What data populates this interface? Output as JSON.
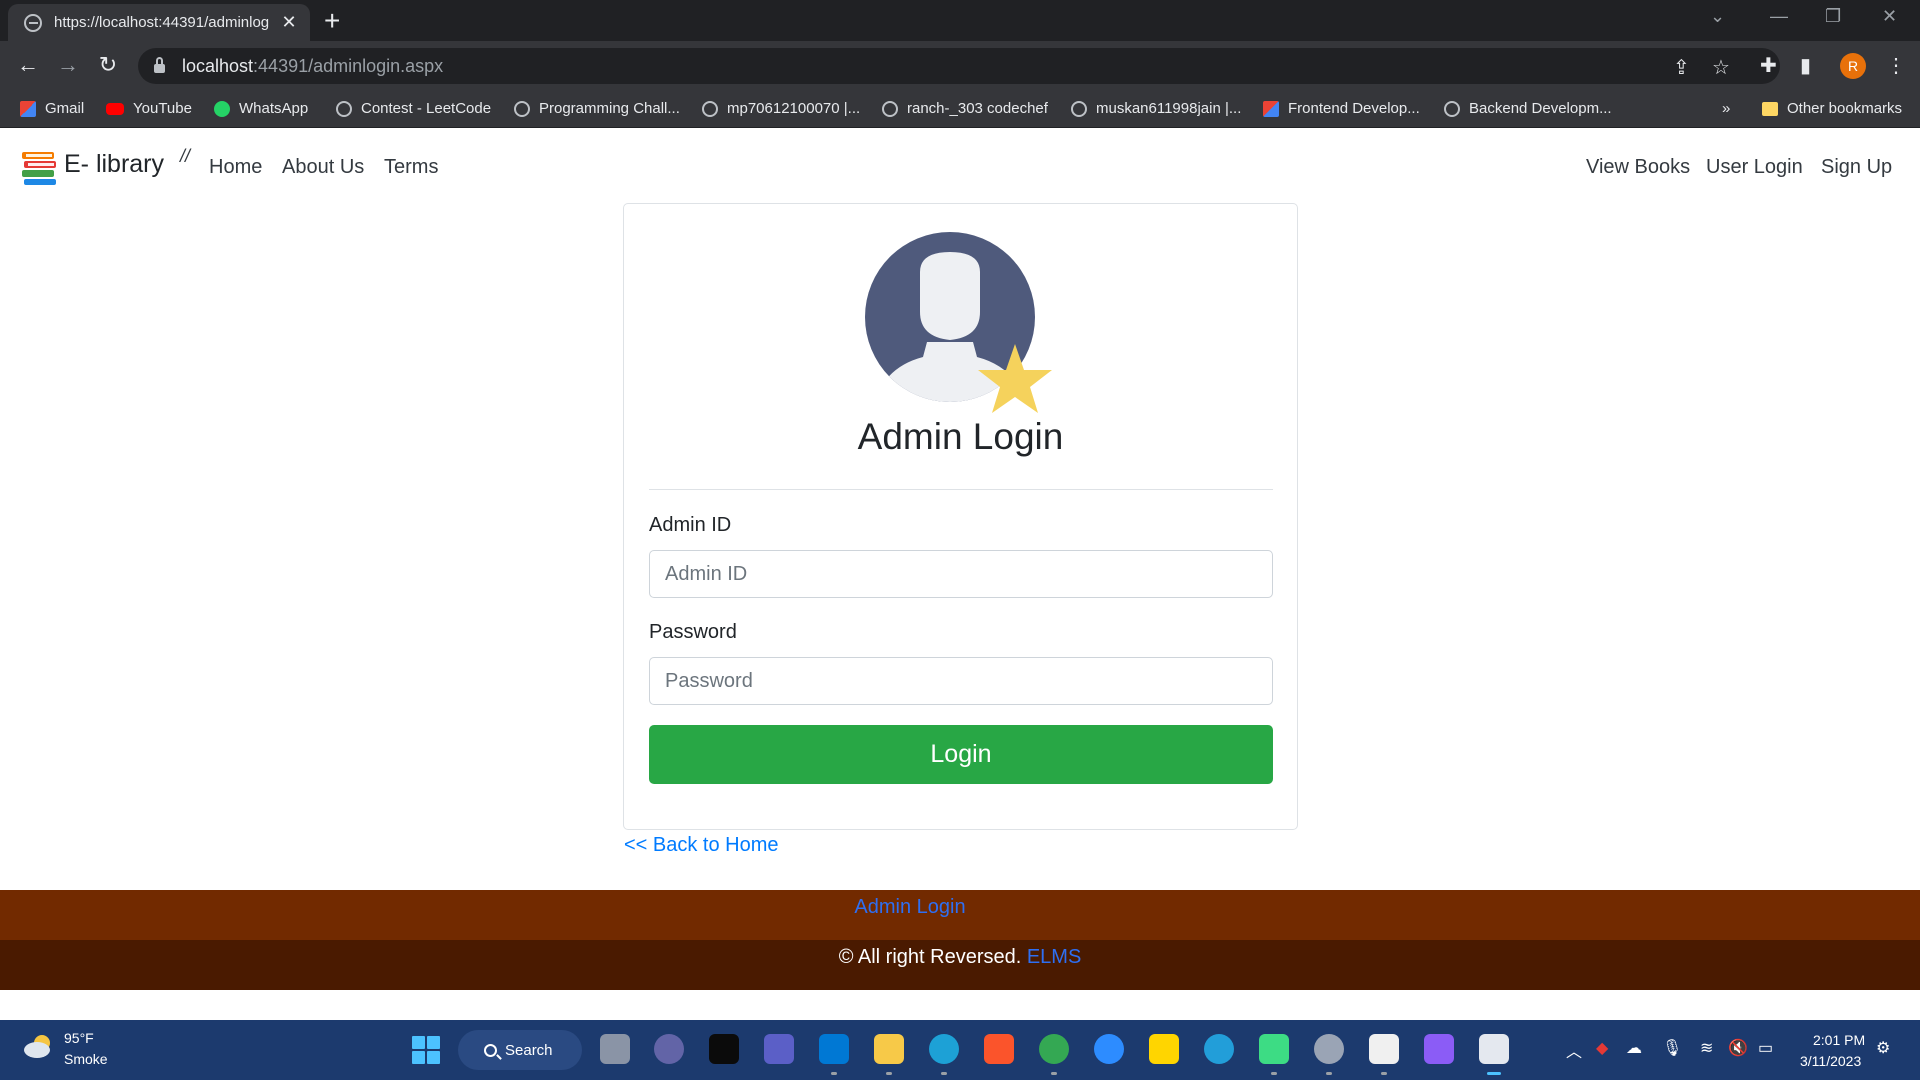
{
  "browser": {
    "tab_title": "https://localhost:44391/adminlog",
    "url_host": "localhost",
    "url_rest": ":44391/adminlogin.aspx",
    "profile_initial": "R",
    "bookmarks": [
      {
        "label": "Gmail",
        "icon": "gmail-icon"
      },
      {
        "label": "YouTube",
        "icon": "youtube-icon"
      },
      {
        "label": "WhatsApp",
        "icon": "whatsapp-icon"
      },
      {
        "label": "Contest - LeetCode",
        "icon": "globe-icon"
      },
      {
        "label": "Programming Chall...",
        "icon": "globe-icon"
      },
      {
        "label": "mp70612100070 |...",
        "icon": "globe-icon"
      },
      {
        "label": "ranch-_303 codechef",
        "icon": "globe-icon"
      },
      {
        "label": "muskan611998jain |...",
        "icon": "globe-icon"
      },
      {
        "label": "Frontend Develop...",
        "icon": "gmail-icon"
      },
      {
        "label": "Backend Developm...",
        "icon": "globe-icon"
      }
    ],
    "bookmarks_overflow": "»",
    "other_bookmarks": "Other bookmarks"
  },
  "navbar": {
    "brand": "E- library",
    "slashes": "//",
    "links": [
      "Home",
      "About Us",
      "Terms"
    ],
    "right_links": [
      "View Books",
      "User Login",
      "Sign Up"
    ]
  },
  "login": {
    "title": "Admin Login",
    "id_label": "Admin ID",
    "id_placeholder": "Admin ID",
    "password_label": "Password",
    "password_placeholder": "Password",
    "button": "Login",
    "back_link": "<< Back to Home"
  },
  "footer": {
    "admin_link": "Admin Login",
    "copyright": "© All right Reversed. ",
    "brand_link": "ELMS"
  },
  "taskbar": {
    "temperature": "95°F",
    "condition": "Smoke",
    "search": "Search",
    "time": "2:01 PM",
    "date": "3/11/2023"
  },
  "colors": {
    "success": "#28a745",
    "link": "#007bff",
    "footer_top": "#722a00",
    "footer_bottom": "#4a1a00",
    "avatar_bg": "#4f5a7c",
    "star": "#f5d25c"
  }
}
